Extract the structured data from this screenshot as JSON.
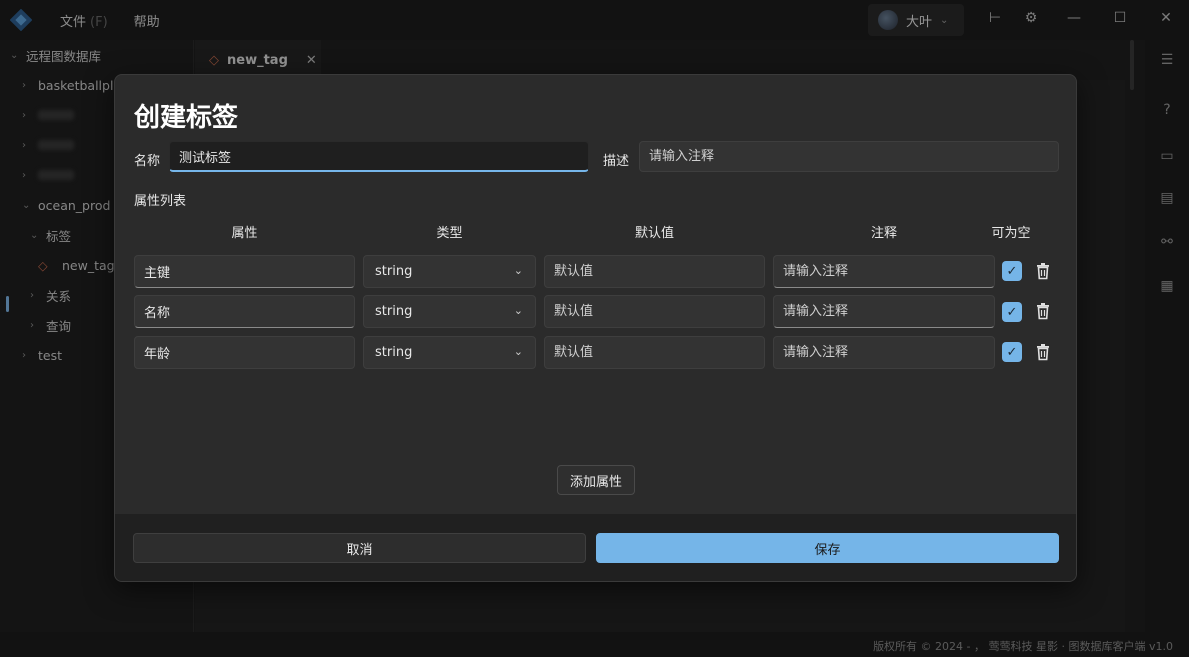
{
  "app": {
    "menu": [
      {
        "label": "文件",
        "hint": "(F)"
      },
      {
        "label": "帮助",
        "hint": ""
      }
    ],
    "user_name": "大叶"
  },
  "sidebar": {
    "root_label": "远程图数据库",
    "items": [
      {
        "label": "basketballpla"
      },
      {
        "label": "ocean_prod"
      },
      {
        "label": "标签"
      },
      {
        "label": "new_tag"
      },
      {
        "label": "关系"
      },
      {
        "label": "查询"
      },
      {
        "label": "test"
      }
    ]
  },
  "tab": {
    "label": "new_tag"
  },
  "status": {
    "copyright": "版权所有 © 2024 - ， 莺莺科技 星影 · 图数据库客户端 v1.0"
  },
  "colors": {
    "accent": "#75b5e8",
    "modal_bg": "#2b2b2b",
    "app_bg": "#202020"
  },
  "modal": {
    "title": "创建标签",
    "name_label": "名称",
    "name_value": "测试标签",
    "desc_label": "描述",
    "desc_placeholder": "请输入注释",
    "props_title": "属性列表",
    "columns": {
      "attr": "属性",
      "type": "类型",
      "default": "默认值",
      "comment": "注释",
      "nullable": "可为空"
    },
    "rows": [
      {
        "name": "主键",
        "type": "string",
        "default_placeholder": "默认值",
        "comment_placeholder": "请输入注释",
        "nullable": true
      },
      {
        "name": "名称",
        "type": "string",
        "default_placeholder": "默认值",
        "comment_placeholder": "请输入注释",
        "nullable": true
      },
      {
        "name": "年龄",
        "type": "string",
        "default_placeholder": "默认值",
        "comment_placeholder": "请输入注释",
        "nullable": true
      }
    ],
    "add_label": "添加属性",
    "cancel_label": "取消",
    "save_label": "保存"
  }
}
